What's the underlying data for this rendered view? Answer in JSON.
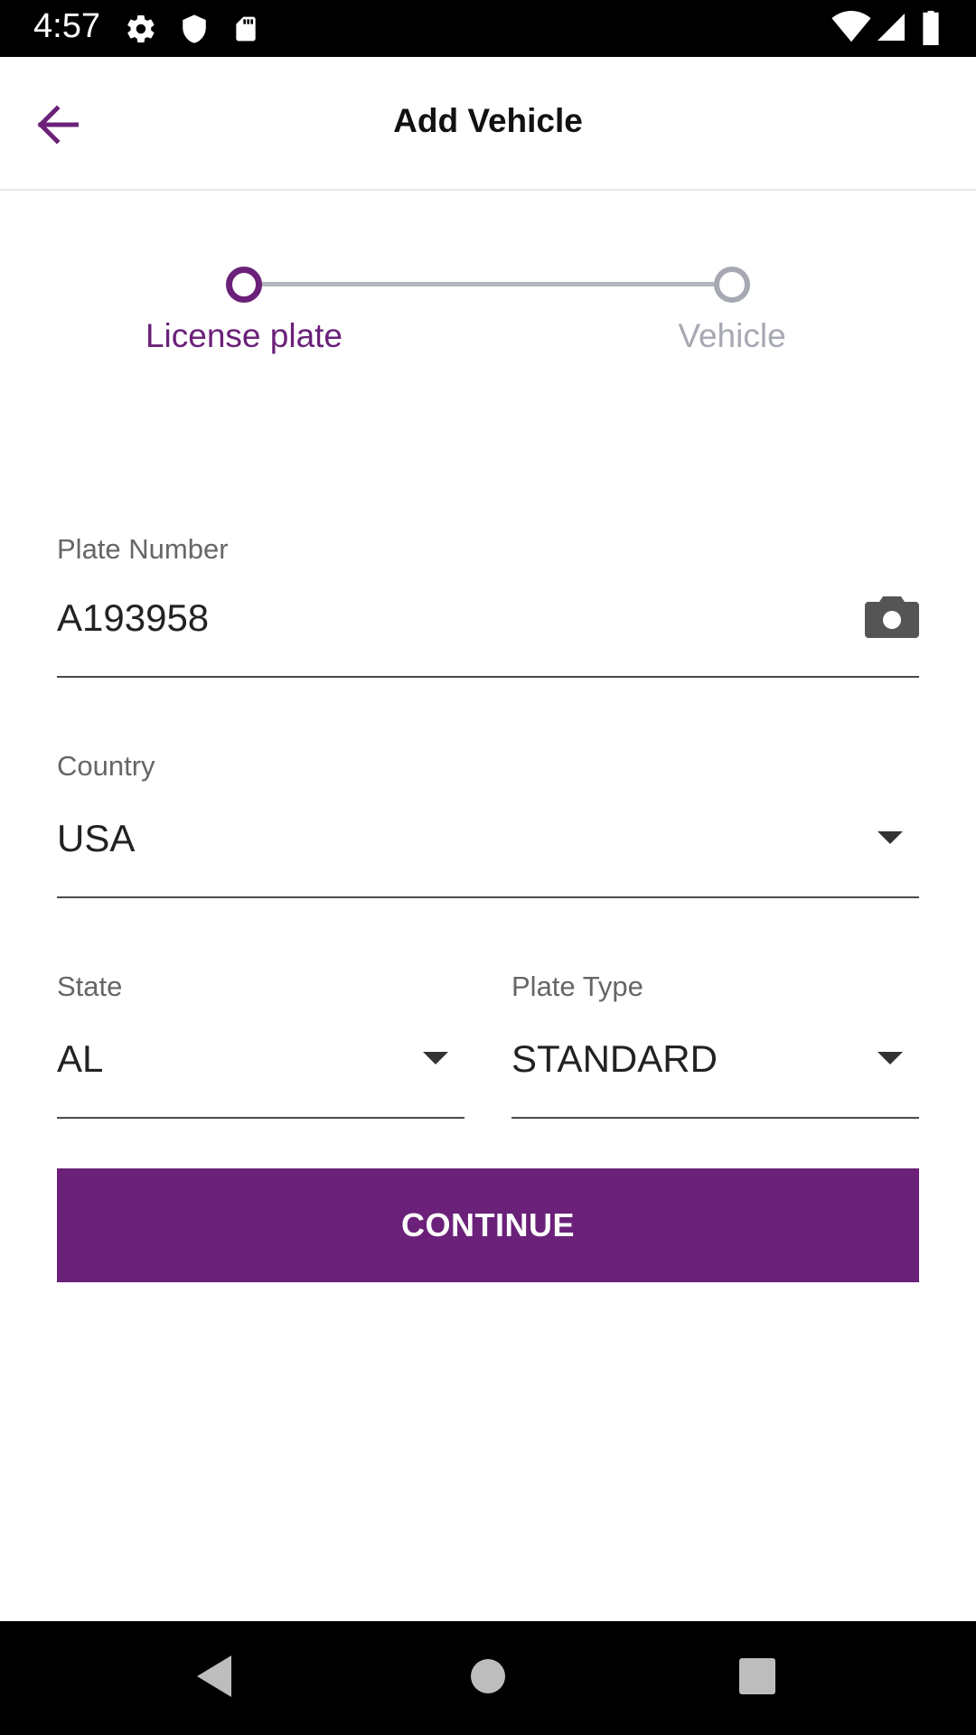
{
  "status_bar": {
    "time": "4:57",
    "icons_left": [
      "gear-icon",
      "shield-icon",
      "sd-card-icon"
    ],
    "icons_right": [
      "wifi-icon",
      "cell-signal-icon",
      "battery-icon"
    ]
  },
  "app_bar": {
    "title": "Add Vehicle",
    "back_icon": "arrow-left-icon"
  },
  "stepper": {
    "steps": [
      {
        "label": "License plate",
        "state": "active"
      },
      {
        "label": "Vehicle",
        "state": "inactive"
      }
    ]
  },
  "form": {
    "plate_number": {
      "label": "Plate Number",
      "value": "A193958",
      "icon": "camera-icon"
    },
    "country": {
      "label": "Country",
      "value": "USA"
    },
    "state": {
      "label": "State",
      "value": "AL"
    },
    "plate_type": {
      "label": "Plate Type",
      "value": "STANDARD"
    }
  },
  "actions": {
    "continue_label": "CONTINUE"
  },
  "colors": {
    "primary": "#6b2179",
    "inactive": "#a6a9b2",
    "status_bar": "#000000"
  },
  "nav_bar": {
    "buttons": [
      "back-triangle-icon",
      "home-circle-icon",
      "recents-square-icon"
    ]
  }
}
